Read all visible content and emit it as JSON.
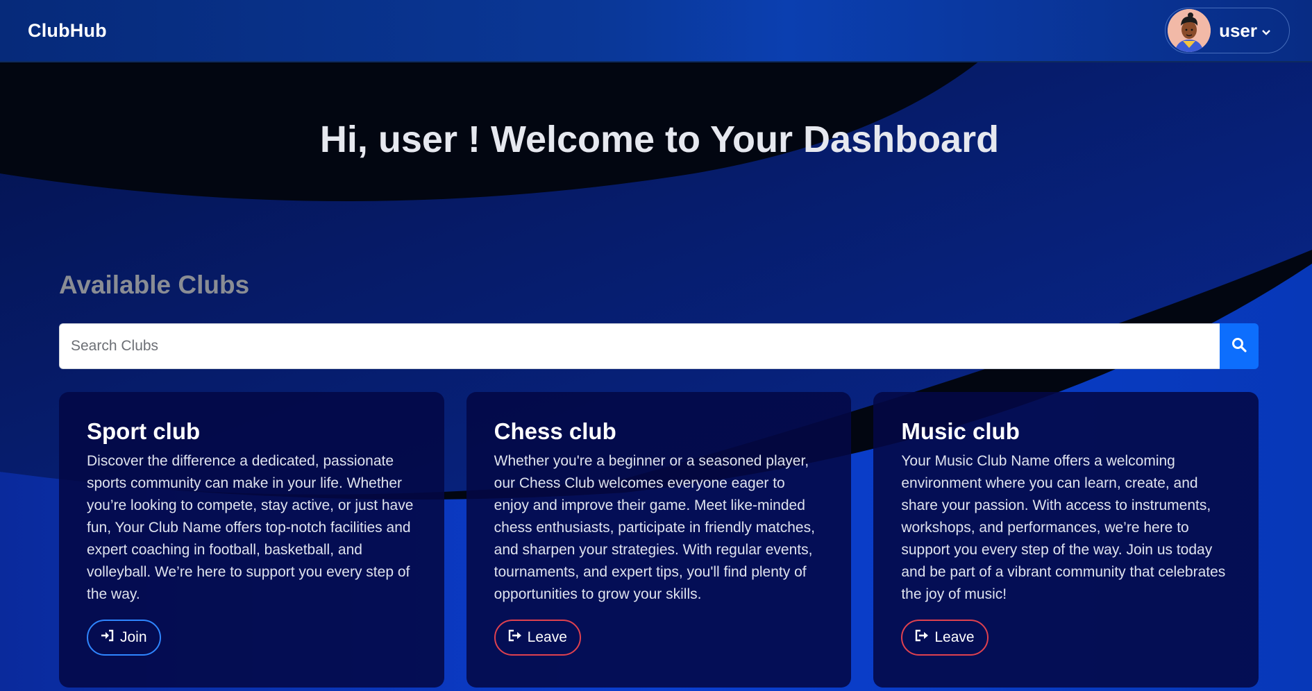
{
  "navbar": {
    "brand": "ClubHub",
    "user_name": "user"
  },
  "hero": {
    "title": "Hi, user ! Welcome to Your Dashboard"
  },
  "clubs_section": {
    "title": "Available Clubs",
    "search_placeholder": "Search Clubs"
  },
  "clubs": [
    {
      "name": "Sport club",
      "description": "Discover the difference a dedicated, passionate sports community can make in your life. Whether you’re looking to compete, stay active, or just have fun, Your Club Name offers top-notch facilities and expert coaching in football, basketball, and volleyball. We’re here to support you every step of the way.",
      "action": "Join"
    },
    {
      "name": "Chess club",
      "description": "Whether you're a beginner or a seasoned player, our Chess Club welcomes everyone eager to enjoy and improve their game. Meet like-minded chess enthusiasts, participate in friendly matches, and sharpen your strategies. With regular events, tournaments, and expert tips, you'll find plenty of opportunities to grow your skills.",
      "action": "Leave"
    },
    {
      "name": "Music club",
      "description": "Your Music Club Name offers a welcoming environment where you can learn, create, and share your passion. With access to instruments, workshops, and performances, we’re here to support you every step of the way. Join us today and be part of a vibrant community that celebrates the joy of music!",
      "action": "Leave"
    }
  ],
  "colors": {
    "primary": "#0d6efd",
    "join_border": "#2f86ff",
    "leave_border": "#e0414f",
    "background": "#02050f"
  },
  "icons": {
    "search": "search-icon",
    "join": "sign-in-icon",
    "leave": "sign-out-icon",
    "dropdown": "chevron-down-icon"
  }
}
